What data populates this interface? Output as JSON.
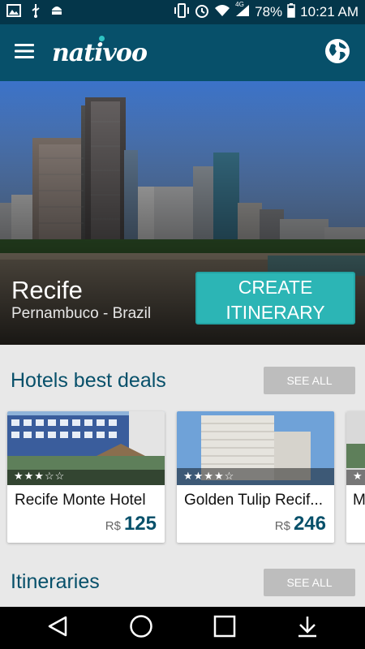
{
  "status_bar": {
    "battery": "78%",
    "time": "10:21 AM",
    "network": "4G"
  },
  "app": {
    "logo_text": "nativoo",
    "menu_icon": "hamburger-icon",
    "globe_icon": "globe-icon"
  },
  "hero": {
    "city": "Recife",
    "region": "Pernambuco - Brazil",
    "cta_line1": "CREATE",
    "cta_line2": "ITINERARY"
  },
  "hotels_section": {
    "title": "Hotels best deals",
    "see_all": "SEE ALL",
    "hotels": [
      {
        "name": "Recife Monte Hotel",
        "currency": "R$",
        "price": "125",
        "stars": "★★★☆☆"
      },
      {
        "name": "Golden Tulip Recif...",
        "currency": "R$",
        "price": "246",
        "stars": "★★★★☆"
      },
      {
        "name": "M",
        "currency": "",
        "price": "",
        "stars": "★"
      }
    ]
  },
  "itineraries_section": {
    "title": "Itineraries",
    "see_all": "SEE ALL"
  },
  "colors": {
    "status_bar": "#04364a",
    "app_bar": "#07506a",
    "accent": "#2cb5b5",
    "section_title": "#07506a"
  }
}
